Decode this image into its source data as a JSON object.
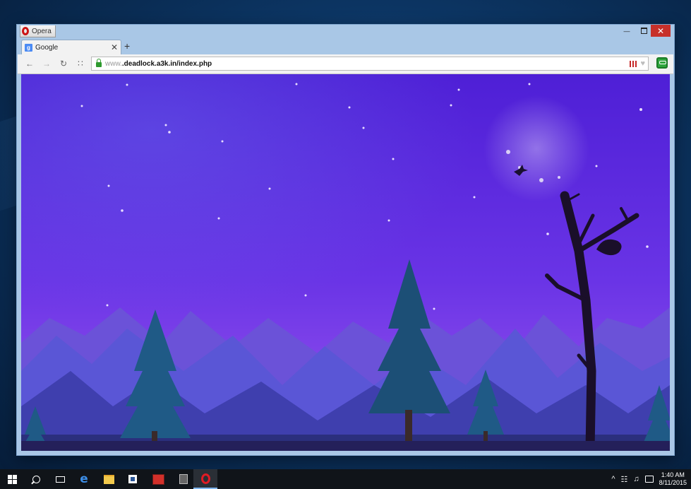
{
  "window": {
    "menu_label": "Opera",
    "minimize_glyph": "—",
    "close_glyph": "✕"
  },
  "tabs": [
    {
      "label": "Google",
      "favicon": "google-icon",
      "close_glyph": "✕"
    }
  ],
  "new_tab_glyph": "+",
  "toolbar": {
    "back_glyph": "←",
    "forward_glyph": "→",
    "reload_glyph": "↻",
    "speed_dial_glyph": "∷",
    "url_prefix": "www.",
    "url_main": ".deadlock.a3k.in/index.php"
  },
  "page": {
    "scene": "night-sky-mountains-moon-trees",
    "colors": {
      "sky_top": "#5a22d8",
      "sky_bottom": "#8a49e8",
      "moon": "#f4efff"
    }
  },
  "taskbar": {
    "items": [
      {
        "name": "start-icon"
      },
      {
        "name": "search-icon"
      },
      {
        "name": "task-view-icon"
      },
      {
        "name": "edge-icon",
        "glyph": "e"
      },
      {
        "name": "file-explorer-icon"
      },
      {
        "name": "store-icon"
      },
      {
        "name": "app-icon"
      },
      {
        "name": "app2-icon"
      },
      {
        "name": "opera-icon"
      }
    ],
    "tray": {
      "chevron": "^",
      "network": "☷",
      "volume": "♫",
      "time": "1:40 AM",
      "date": "8/11/2015"
    }
  }
}
